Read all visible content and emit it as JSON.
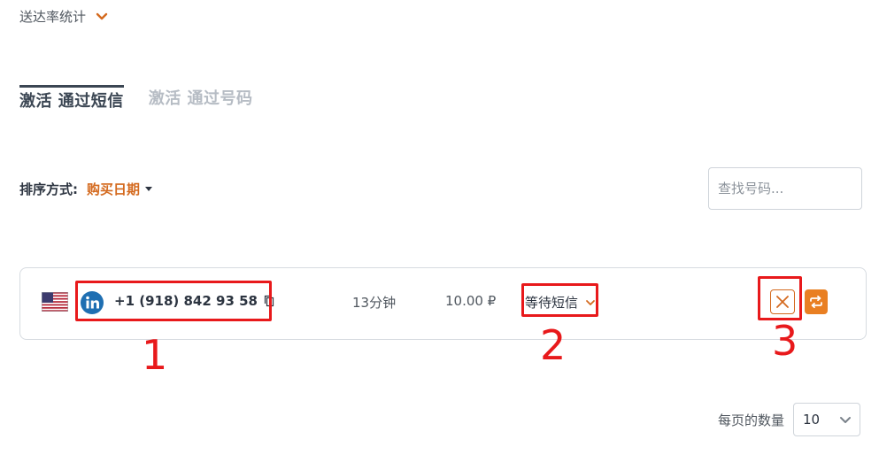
{
  "stats": {
    "label": "送达率统计",
    "icon": "chevron-down-icon"
  },
  "tabs": [
    {
      "label": "激活 通过短信",
      "active": true
    },
    {
      "label": "激活 通过号码",
      "active": false
    }
  ],
  "sort": {
    "label": "排序方式:",
    "value": "购买日期"
  },
  "search": {
    "placeholder": "查找号码..."
  },
  "row": {
    "country": "us-flag",
    "service": "linkedin-icon",
    "phone": "+1 (918) 842 93 58",
    "duration": "13分钟",
    "price": "10.00 ₽",
    "status": "等待短信"
  },
  "annotations": [
    "1",
    "2",
    "3"
  ],
  "pagination": {
    "label": "每页的数量",
    "value": "10"
  },
  "colors": {
    "accent": "#e97f22",
    "sort_value": "#d46a1f",
    "annotation": "#e8191b"
  }
}
